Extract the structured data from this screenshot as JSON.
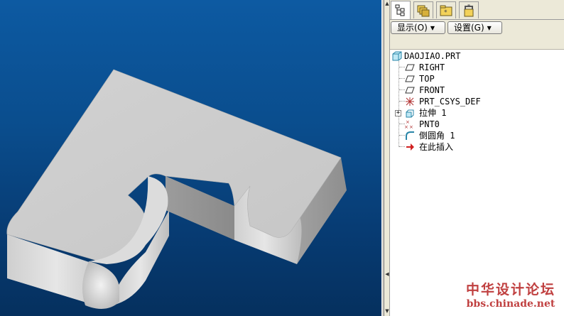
{
  "tabs": [
    {
      "name": "model-tree-tab",
      "icon": "model-tree-icon",
      "active": true
    },
    {
      "name": "layers-tab",
      "icon": "layers-icon",
      "active": false
    },
    {
      "name": "folder-tab",
      "icon": "folder-icon",
      "active": false
    },
    {
      "name": "favorites-tab",
      "icon": "favorites-icon",
      "active": false
    }
  ],
  "toolbar": {
    "show_label": "显示(O)",
    "settings_label": "设置(G)"
  },
  "tree": {
    "root": "DAOJIAO.PRT",
    "items": [
      {
        "label": "RIGHT",
        "icon": "datum-plane-icon"
      },
      {
        "label": "TOP",
        "icon": "datum-plane-icon"
      },
      {
        "label": "FRONT",
        "icon": "datum-plane-icon"
      },
      {
        "label": "PRT_CSYS_DEF",
        "icon": "coordinate-system-icon"
      },
      {
        "label": "拉伸 1",
        "icon": "extrude-icon",
        "expandable": true
      },
      {
        "label": "PNT0",
        "icon": "datum-point-icon"
      },
      {
        "label": "倒圆角 1",
        "icon": "round-icon"
      },
      {
        "label": "在此插入",
        "icon": "insert-here-arrow-icon"
      }
    ]
  },
  "watermark": {
    "line1": "中华设计论坛",
    "line2": "bbs.chinade.net"
  },
  "colors": {
    "viewport_top": "#0d5aa2",
    "viewport_bottom": "#05305e",
    "model_face": "#c8c8c8"
  }
}
